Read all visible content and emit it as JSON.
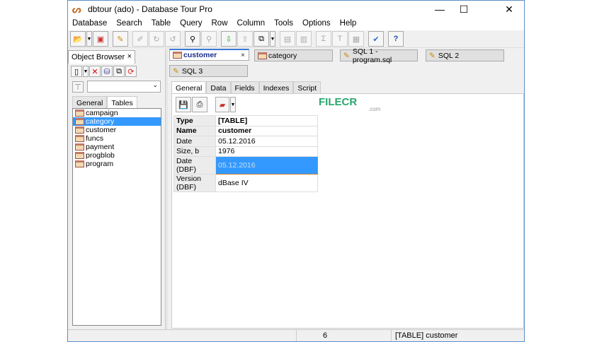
{
  "window": {
    "title": "dbtour (ado) - Database Tour Pro",
    "minimize": "—",
    "maximize": "☐",
    "close": "✕"
  },
  "menu": [
    "Database",
    "Search",
    "Table",
    "Query",
    "Row",
    "Column",
    "Tools",
    "Options",
    "Help"
  ],
  "object_browser": {
    "title": "Object Browser",
    "close": "×",
    "tabs": [
      "General",
      "Tables"
    ],
    "tables": [
      "campaign",
      "category",
      "customer",
      "funcs",
      "payment",
      "progblob",
      "program"
    ],
    "selected": "category"
  },
  "doc_tabs": [
    {
      "label": "customer",
      "close": "×"
    },
    {
      "label": "category"
    },
    {
      "label": "SQL 1 - program.sql"
    },
    {
      "label": "SQL 2"
    },
    {
      "label": "SQL 3"
    }
  ],
  "panel_tabs": [
    "General",
    "Data",
    "Fields",
    "Indexes",
    "Script"
  ],
  "properties": [
    {
      "key": "Type",
      "value": "[TABLE]"
    },
    {
      "key": "Name",
      "value": "customer"
    },
    {
      "key": "Date",
      "value": "05.12.2016"
    },
    {
      "key": "Size, b",
      "value": "1976"
    },
    {
      "key": "Date (DBF)",
      "value": "05.12.2016"
    },
    {
      "key": "Version (DBF)",
      "value": "dBase IV"
    }
  ],
  "status": {
    "count": "6",
    "info": "[TABLE] customer"
  },
  "watermark": {
    "text": "FILECR",
    "sub": ".com"
  }
}
